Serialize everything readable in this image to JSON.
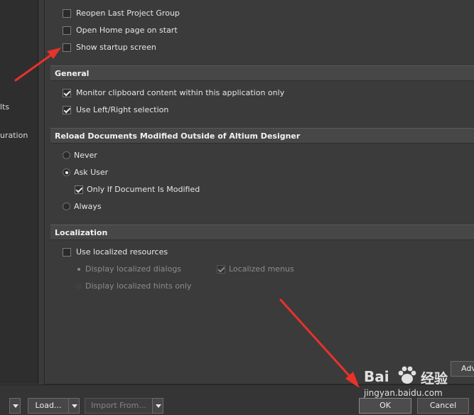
{
  "left_nav": {
    "items": [
      "lts",
      "uration"
    ]
  },
  "system_general": {
    "options": [
      {
        "label": "Reopen Last Project Group",
        "checked": false
      },
      {
        "label": "Open Home page on start",
        "checked": false
      },
      {
        "label": "Show startup screen",
        "checked": false
      }
    ]
  },
  "general": {
    "header": "General",
    "options": [
      {
        "label": "Monitor clipboard content within this application only",
        "checked": true
      },
      {
        "label": "Use Left/Right selection",
        "checked": true
      }
    ]
  },
  "reload": {
    "header": "Reload Documents Modified Outside of Altium Designer",
    "never": "Never",
    "ask_user": "Ask User",
    "only_if_modified": "Only If Document Is Modified",
    "always": "Always",
    "selected": "Ask User"
  },
  "localization": {
    "header": "Localization",
    "use_localized": "Use localized resources",
    "display_dialogs": "Display localized dialogs",
    "display_hints": "Display localized hints only",
    "localized_menus": "Localized menus"
  },
  "buttons": {
    "load": "Load...",
    "import_from": "Import From...",
    "advanced": "Adv",
    "ok": "OK",
    "cancel": "Cancel"
  },
  "watermark": {
    "brand": "Bai",
    "brand_tail": "经验",
    "url": "jingyan.baidu.com"
  },
  "colors": {
    "annotation_arrow": "#e8322a",
    "background": "#3a3a3a",
    "header": "#474747"
  }
}
